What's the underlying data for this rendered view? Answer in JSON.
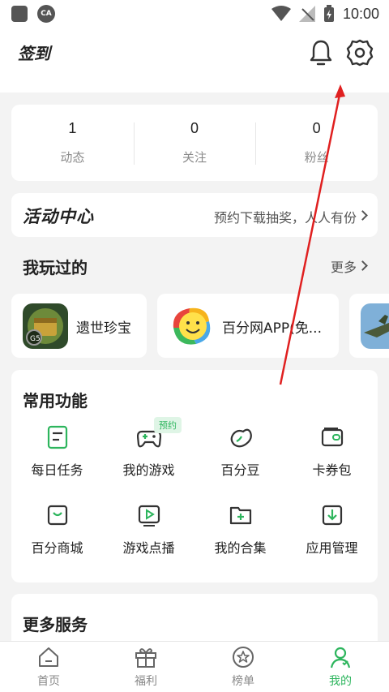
{
  "status_bar": {
    "time": "10:00"
  },
  "header": {
    "signin_label": "签到"
  },
  "stats": [
    {
      "value": "1",
      "label": "动态"
    },
    {
      "value": "0",
      "label": "关注"
    },
    {
      "value": "0",
      "label": "粉丝"
    }
  ],
  "activity": {
    "title": "活动中心",
    "desc": "预约下载抽奖，人人有份"
  },
  "played": {
    "title": "我玩过的",
    "more_label": "更多",
    "games": [
      {
        "name": "遗世珍宝"
      },
      {
        "name": "百分网APP(免..."
      },
      {
        "name": ""
      }
    ]
  },
  "functions": {
    "title": "常用功能",
    "badge": "预约",
    "items": [
      {
        "label": "每日任务",
        "icon": "task-icon"
      },
      {
        "label": "我的游戏",
        "icon": "gamepad-icon"
      },
      {
        "label": "百分豆",
        "icon": "bean-icon"
      },
      {
        "label": "卡券包",
        "icon": "wallet-icon"
      },
      {
        "label": "百分商城",
        "icon": "shop-icon"
      },
      {
        "label": "游戏点播",
        "icon": "play-icon"
      },
      {
        "label": "我的合集",
        "icon": "folder-add-icon"
      },
      {
        "label": "应用管理",
        "icon": "download-icon"
      }
    ]
  },
  "services": {
    "title": "更多服务"
  },
  "nav": [
    {
      "label": "首页",
      "icon": "home-icon"
    },
    {
      "label": "福利",
      "icon": "gift-icon"
    },
    {
      "label": "榜单",
      "icon": "star-badge-icon"
    },
    {
      "label": "我的",
      "icon": "user-icon",
      "active": true
    }
  ],
  "colors": {
    "accent": "#2db55d",
    "annotation": "#e02020"
  }
}
